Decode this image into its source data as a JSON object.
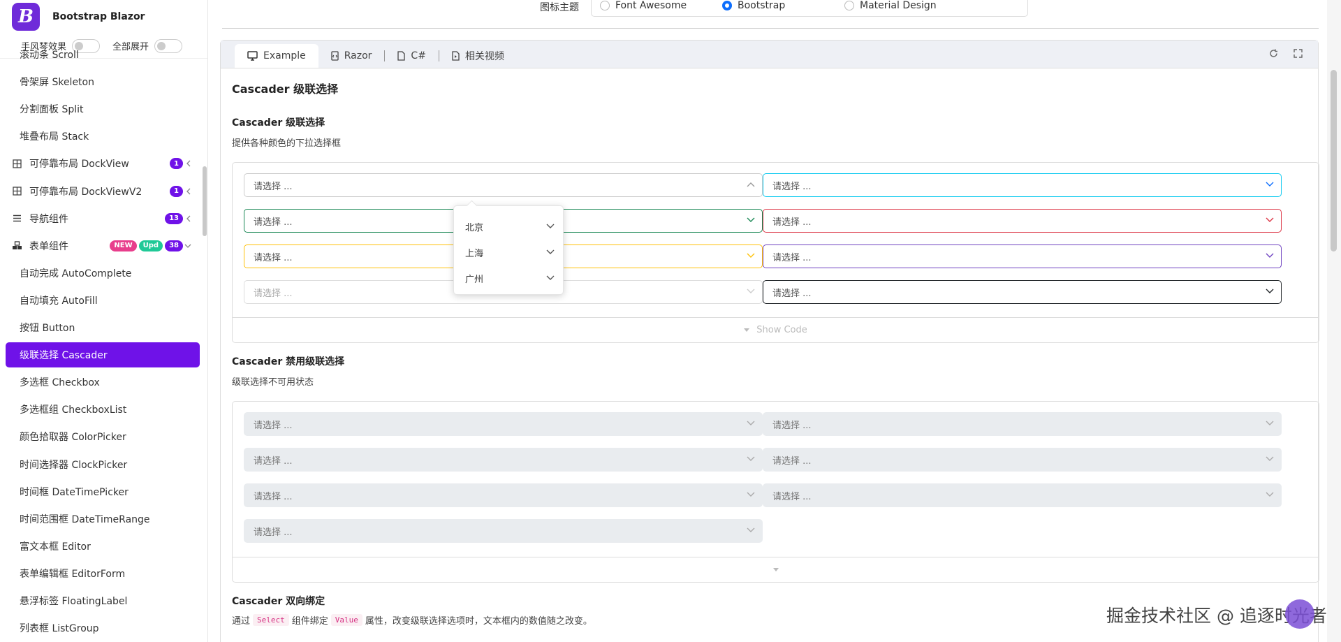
{
  "brand": {
    "logo": "B",
    "title": "Bootstrap Blazor"
  },
  "switches": [
    {
      "label": "手风琴效果"
    },
    {
      "label": "全部展开"
    }
  ],
  "menu": [
    {
      "label": "滚动条 Scroll",
      "type": "sub"
    },
    {
      "label": "骨架屏 Skeleton",
      "type": "sub"
    },
    {
      "label": "分割面板 Split",
      "type": "sub"
    },
    {
      "label": "堆叠布局 Stack",
      "type": "sub"
    },
    {
      "label": "可停靠布局 DockView",
      "type": "group",
      "icon": "grid-icon",
      "badge": "1"
    },
    {
      "label": "可停靠布局 DockViewV2",
      "type": "group",
      "icon": "grid-icon",
      "badge": "1"
    },
    {
      "label": "导航组件",
      "type": "group",
      "icon": "list-icon",
      "badge": "13"
    },
    {
      "label": "表单组件",
      "type": "group",
      "icon": "cubes-icon",
      "badges": [
        "NEW",
        "Upd",
        "38"
      ]
    },
    {
      "label": "自动完成 AutoComplete",
      "type": "sub"
    },
    {
      "label": "自动填充 AutoFill",
      "type": "sub"
    },
    {
      "label": "按钮 Button",
      "type": "sub"
    },
    {
      "label": "级联选择 Cascader",
      "type": "sub",
      "active": true
    },
    {
      "label": "多选框 Checkbox",
      "type": "sub"
    },
    {
      "label": "多选框组 CheckboxList",
      "type": "sub"
    },
    {
      "label": "颜色拾取器 ColorPicker",
      "type": "sub"
    },
    {
      "label": "时间选择器 ClockPicker",
      "type": "sub"
    },
    {
      "label": "时间框 DateTimePicker",
      "type": "sub"
    },
    {
      "label": "时间范围框 DateTimeRange",
      "type": "sub"
    },
    {
      "label": "富文本框 Editor",
      "type": "sub"
    },
    {
      "label": "表单编辑框 EditorForm",
      "type": "sub"
    },
    {
      "label": "悬浮标签 FloatingLabel",
      "type": "sub"
    },
    {
      "label": "列表框 ListGroup",
      "type": "sub"
    }
  ],
  "theme": {
    "label": "图标主题",
    "options": [
      "Font Awesome",
      "Bootstrap",
      "Material Design"
    ],
    "selected": "Bootstrap"
  },
  "tabs": [
    {
      "label": "Example",
      "icon": "monitor-icon",
      "active": true
    },
    {
      "label": "Razor",
      "icon": "file-code-icon"
    },
    {
      "label": "C#",
      "icon": "file-icon"
    },
    {
      "label": "相关视频",
      "icon": "video-file-icon"
    }
  ],
  "page_title": "Cascader 级联选择",
  "section1": {
    "title": "Cascader 级联选择",
    "desc": "提供各种颜色的下拉选择框",
    "placeholder": "请选择 ...",
    "show_code": "Show Code",
    "colors": {
      "primary": "#0d6efd",
      "success": "#198754",
      "warning": "#ffc107",
      "info": "#0dcaf0",
      "danger": "#dc3545",
      "secondary": "#6f42c1",
      "dark": "#212529"
    },
    "dropdown": [
      "北京",
      "上海",
      "广州"
    ]
  },
  "section2": {
    "title": "Cascader 禁用级联选择",
    "desc": "级联选择不可用状态",
    "placeholder": "请选择 ..."
  },
  "section3": {
    "title": "Cascader 双向绑定",
    "desc_pre": "通过",
    "code1": "Select",
    "desc_mid": "组件绑定",
    "code2": "Value",
    "desc_post": "属性，改变级联选择选项时，文本框内的数值随之改变。"
  },
  "watermark": "掘金技术社区 @ 追逐时光者"
}
